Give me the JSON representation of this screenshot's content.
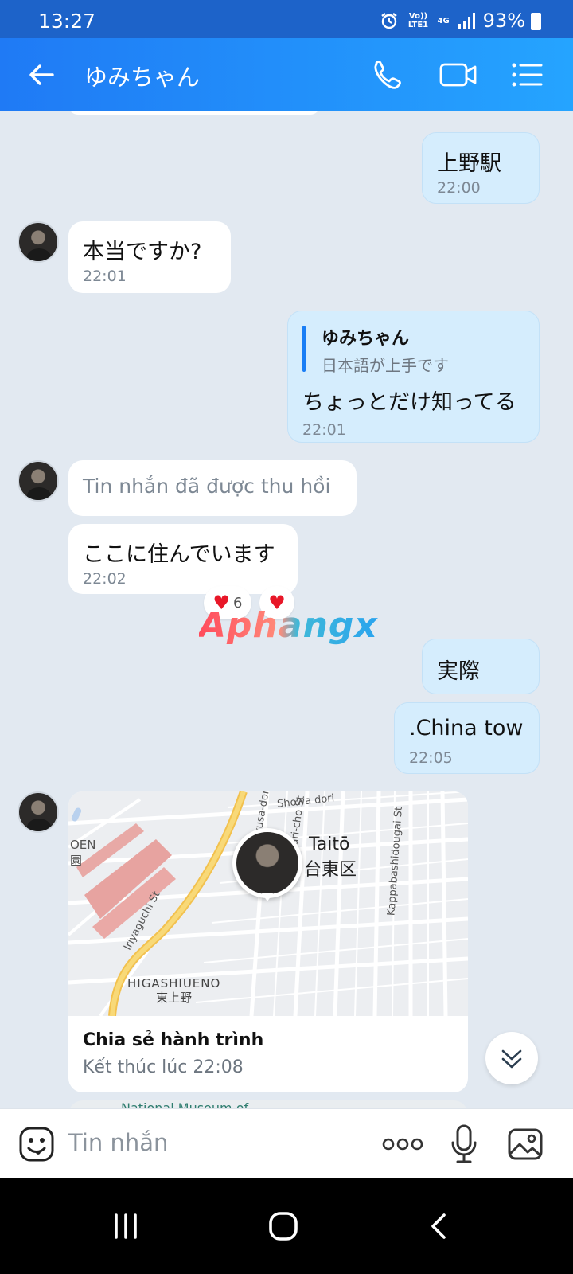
{
  "status_bar": {
    "time": "13:27",
    "volte": "Vo)) LTE1",
    "network": "4G",
    "battery": "93%"
  },
  "header": {
    "contact_name": "ゆみちゃん",
    "icons": [
      "back-arrow-icon",
      "phone-icon",
      "video-call-icon",
      "menu-list-icon"
    ]
  },
  "messages": [
    {
      "id": "m1",
      "direction": "out",
      "text": "上野駅",
      "time": "22:00"
    },
    {
      "id": "m2",
      "direction": "in",
      "text": "本当ですか?",
      "time": "22:01"
    },
    {
      "id": "m3",
      "direction": "out",
      "reply_to_name": "ゆみちゃん",
      "reply_to_text": "日本語が上手です",
      "text": "ちょっとだけ知ってる",
      "time": "22:01"
    },
    {
      "id": "m4",
      "direction": "in",
      "text": "Tin nhắn đã được thu hồi",
      "recalled": true
    },
    {
      "id": "m5",
      "direction": "in",
      "text": "ここに住んでいます",
      "time": "22:02",
      "reaction_count": "6"
    },
    {
      "id": "m6",
      "direction": "out",
      "text": "実際"
    },
    {
      "id": "m7",
      "direction": "out",
      "text": ".China tow",
      "time": "22:05"
    }
  ],
  "watermark": "Aphangx",
  "map_card": {
    "labels": [
      "Taitō",
      "台東区",
      "HIGASHIUENO",
      "東上野",
      "OEN",
      "園",
      "Iriyaguchi St",
      "Kappabashidougai St",
      "Showa dori",
      "Asakusa-dori",
      "Inari-cho St"
    ],
    "title": "Chia sẻ hành trình",
    "subtitle": "Kết thúc lúc 22:08",
    "next_card_label": "National Museum of"
  },
  "input": {
    "placeholder": "Tin nhắn"
  },
  "colors": {
    "header_start": "#1f7af5",
    "header_end": "#25a4ff",
    "bubble_out": "#d5edfd",
    "bubble_in": "#ffffff",
    "chat_bg": "#e2e9f1",
    "reply_bar": "#1a7ef5"
  }
}
